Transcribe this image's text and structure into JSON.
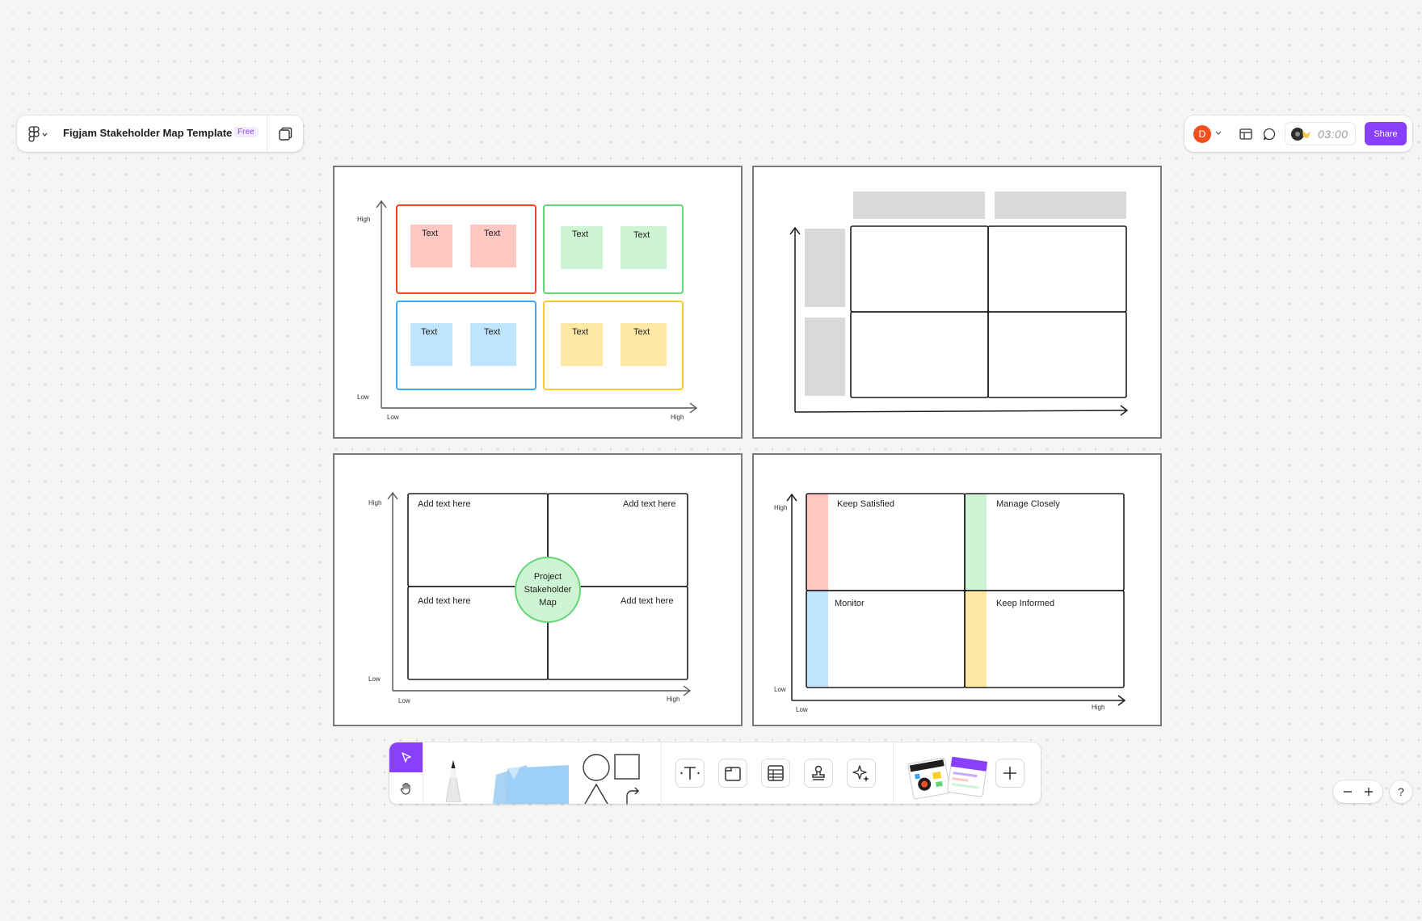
{
  "header": {
    "file_title": "Figjam Stakeholder Map Template",
    "plan_badge": "Free"
  },
  "top_right": {
    "avatar_initial": "D",
    "timer": "03:00",
    "share_label": "Share"
  },
  "colors": {
    "accent": "#8a3ffc",
    "avatar": "#f24e1e",
    "red_sticky": "#ffc7c2",
    "green_sticky": "#cdf4d3",
    "blue_sticky": "#c2e5ff",
    "yellow_sticky": "#ffe8a3",
    "placeholder_gray": "#d9d9d9"
  },
  "templates": {
    "grid_stickies": {
      "y_high": "High",
      "y_low": "Low",
      "x_low": "Low",
      "x_high": "High",
      "stickies": [
        "Text",
        "Text",
        "Text",
        "Text",
        "Text",
        "Text",
        "Text",
        "Text"
      ]
    },
    "center_circle": {
      "y_high": "High",
      "y_low": "Low",
      "x_low": "Low",
      "x_high": "High",
      "quadrants": [
        "Add text here",
        "Add text here",
        "Add text here",
        "Add text here"
      ],
      "circle_lines": [
        "Project",
        "Stakeholder",
        "Map"
      ]
    },
    "labeled_quadrants": {
      "y_high": "High",
      "y_low": "Low",
      "x_low": "Low",
      "x_high": "High",
      "quadrants": [
        "Keep Satisfied",
        "Manage Closely",
        "Monitor",
        "Keep Informed"
      ]
    }
  },
  "toolbar": {
    "tools": [
      "select-tool",
      "hand-tool",
      "pencil-tool",
      "sticky-note-tool",
      "shapes-tool",
      "text-tool",
      "section-tool",
      "table-tool",
      "stamp-tool",
      "ai-tool",
      "templates-tool",
      "more-tool"
    ]
  },
  "help_label": "?"
}
